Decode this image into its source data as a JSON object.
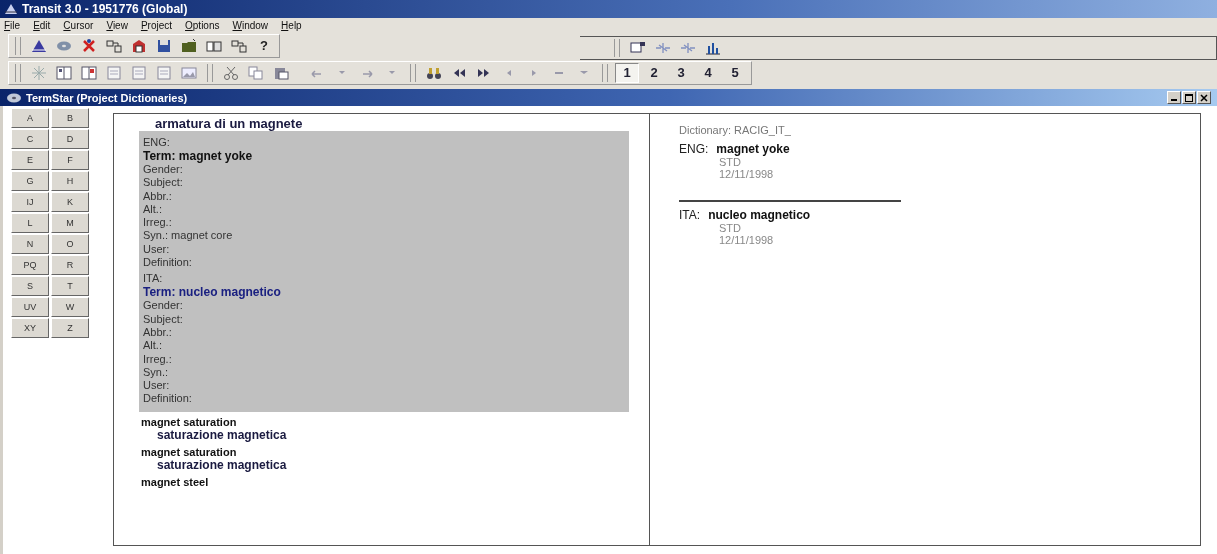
{
  "window": {
    "title": "Transit 3.0 - 1951776 (Global)"
  },
  "menu": [
    {
      "label": "File"
    },
    {
      "label": "Edit"
    },
    {
      "label": "Cursor"
    },
    {
      "label": "View"
    },
    {
      "label": "Project"
    },
    {
      "label": "Options"
    },
    {
      "label": "Window"
    },
    {
      "label": "Help"
    }
  ],
  "toolbar": {
    "help_button": "?",
    "pages": [
      {
        "label": "1",
        "selected": true
      },
      {
        "label": "2",
        "selected": false
      },
      {
        "label": "3",
        "selected": false
      },
      {
        "label": "4",
        "selected": false
      },
      {
        "label": "5",
        "selected": false
      }
    ]
  },
  "child_window": {
    "title": "TermStar (Project Dictionaries)"
  },
  "letters": [
    "A",
    "B",
    "C",
    "D",
    "E",
    "F",
    "G",
    "H",
    "IJ",
    "K",
    "L",
    "M",
    "N",
    "O",
    "PQ",
    "R",
    "S",
    "T",
    "UV",
    "W",
    "XY",
    "Z"
  ],
  "entry": {
    "heading": "armatura di un magnete",
    "sections": [
      {
        "language": "ENG:",
        "term": "Term: magnet yoke",
        "selected": false,
        "fields": [
          "Gender:",
          "Subject:",
          "Abbr.:",
          "Alt.:",
          "Irreg.:",
          "Syn.: magnet core",
          "User:",
          "Definition:"
        ]
      },
      {
        "language": "ITA:",
        "term": "Term: nucleo magnetico",
        "selected": true,
        "fields": [
          "Gender:",
          "Subject:",
          "Abbr.:",
          "Alt.:",
          "Irreg.:",
          "Syn.:",
          "User:",
          "Definition:"
        ]
      }
    ]
  },
  "results": [
    {
      "term": "magnet saturation",
      "translation": "saturazione magnetica"
    },
    {
      "term": "magnet saturation",
      "translation": "saturazione magnetica"
    },
    {
      "term": "magnet steel"
    }
  ],
  "detail": {
    "dictionary": "Dictionary: RACIG_IT_",
    "entries": [
      {
        "language": "ENG:",
        "term": "magnet yoke",
        "status": "STD",
        "date": "12/11/1998"
      },
      {
        "language": "ITA:",
        "term": "nucleo magnetico",
        "status": "STD",
        "date": "12/11/1998"
      }
    ]
  }
}
